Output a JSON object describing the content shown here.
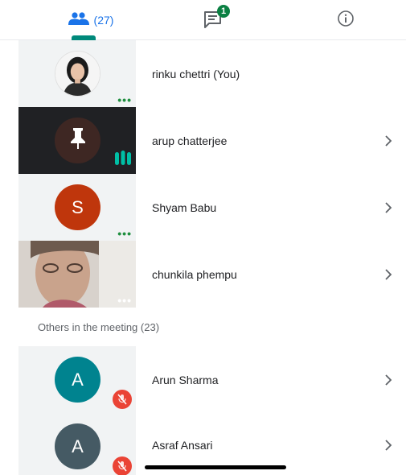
{
  "tabs": {
    "people_count": "(27)",
    "chat_badge": "1",
    "accent": "#1a73e8",
    "indicator_color": "#00897b"
  },
  "participants": [
    {
      "name": "rinku chettri (You)",
      "tile": "photo",
      "status": "dots"
    },
    {
      "name": "arup chatterjee",
      "tile": "pin-dark",
      "status": "speaking"
    },
    {
      "name": "Shyam Babu",
      "tile": "letter",
      "initial": "S",
      "color": "#bf360c",
      "status": "dots"
    },
    {
      "name": "chunkila phempu",
      "tile": "video",
      "status": "dots"
    }
  ],
  "others": {
    "label": "Others in the meeting (23)",
    "items": [
      {
        "name": "Arun Sharma",
        "initial": "A",
        "color": "#00838f",
        "status": "muted"
      },
      {
        "name": "Asraf Ansari",
        "initial": "A",
        "color": "#455a64",
        "status": "muted"
      }
    ]
  },
  "icons": {
    "people": "people-icon",
    "chat": "chat-icon",
    "info": "info-icon",
    "pin": "pin-icon",
    "mic_off": "mic-off-icon",
    "chevron": "chevron-right-icon"
  }
}
